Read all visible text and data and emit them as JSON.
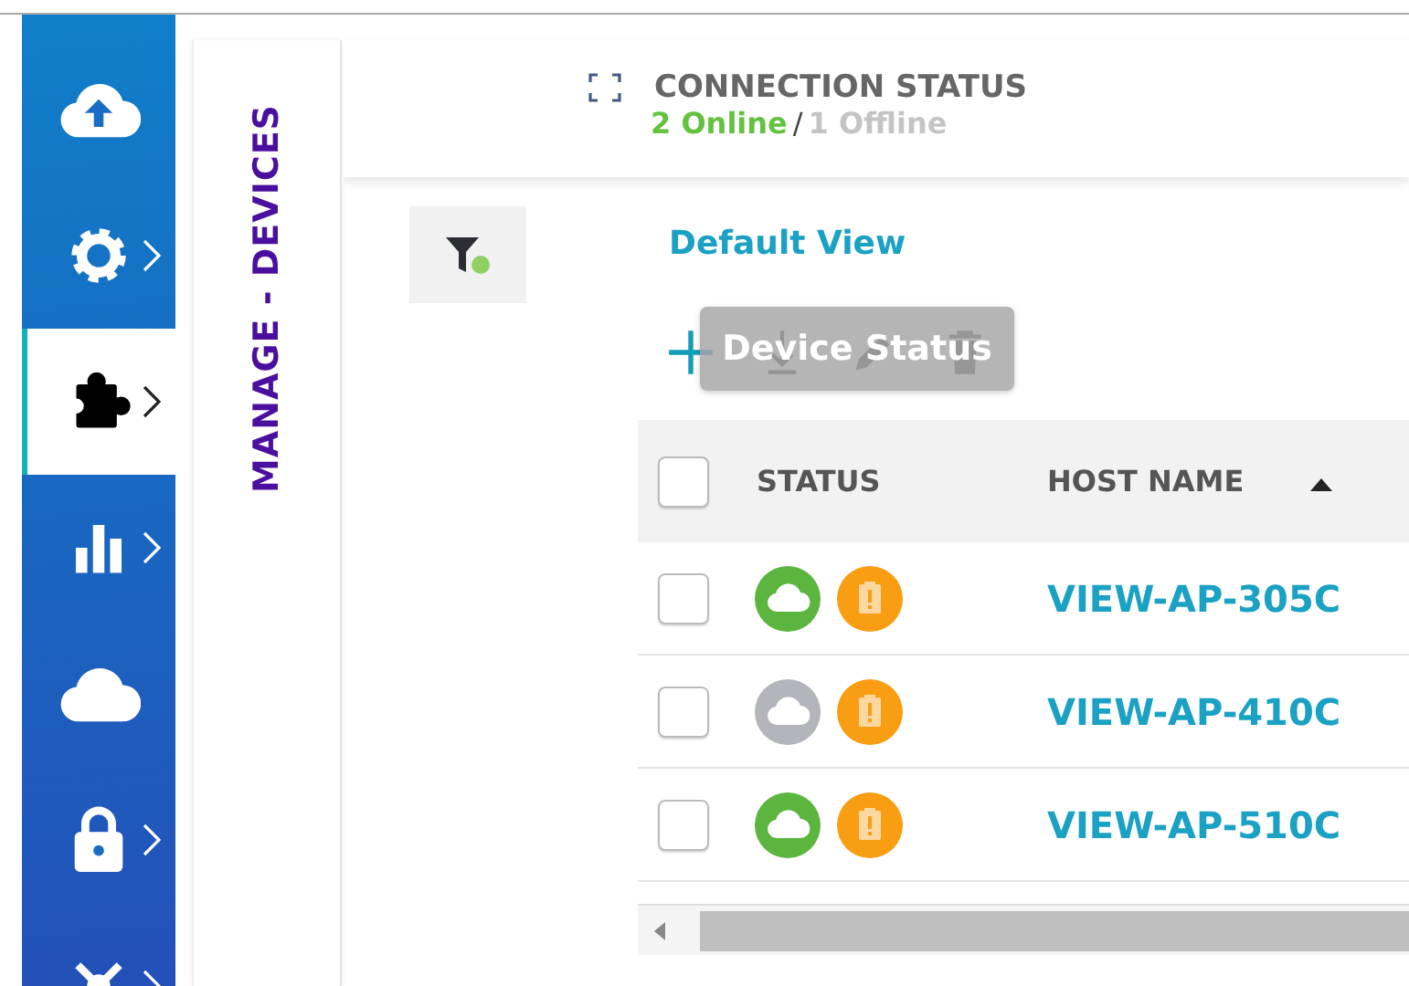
{
  "sidebar": {
    "items": [
      {
        "kind": "cloud-upload",
        "has_submenu": false,
        "selected": false
      },
      {
        "kind": "gear",
        "has_submenu": true,
        "selected": false
      },
      {
        "kind": "puzzle",
        "has_submenu": true,
        "selected": true
      },
      {
        "kind": "chart",
        "has_submenu": true,
        "selected": false
      },
      {
        "kind": "cloud",
        "has_submenu": false,
        "selected": false
      },
      {
        "kind": "lock",
        "has_submenu": true,
        "selected": false
      },
      {
        "kind": "network",
        "has_submenu": true,
        "selected": false
      }
    ]
  },
  "panel_title": "MANAGE - DEVICES",
  "connection_status": {
    "title": "CONNECTION STATUS",
    "online": "2 Online",
    "separator": "/",
    "offline": "1 Offline"
  },
  "filter": {
    "active": true
  },
  "view_name": "Default View",
  "toolbar": {
    "tools": [
      {
        "kind": "add"
      },
      {
        "kind": "download"
      },
      {
        "kind": "edit"
      },
      {
        "kind": "delete"
      }
    ],
    "tooltip": "Device Status"
  },
  "table": {
    "select_all": {
      "checked": false
    },
    "columns": [
      {
        "label": "STATUS",
        "sorted": false
      },
      {
        "label": "HOST NAME",
        "sorted": true
      }
    ],
    "rows": [
      {
        "checked": false,
        "online": true,
        "warning": true,
        "host_name": "VIEW-AP-305C"
      },
      {
        "checked": false,
        "online": false,
        "warning": true,
        "host_name": "VIEW-AP-410C"
      },
      {
        "checked": false,
        "online": true,
        "warning": true,
        "host_name": "VIEW-AP-510C"
      }
    ]
  }
}
